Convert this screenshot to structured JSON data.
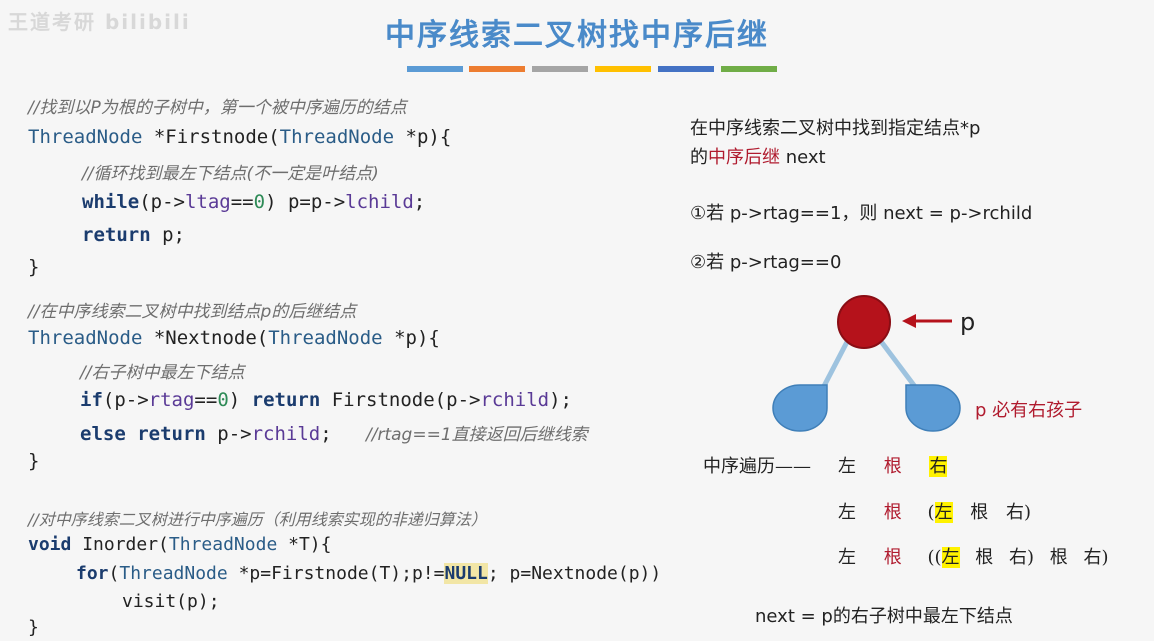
{
  "watermark": "王道考研 bilibili",
  "title": "中序线索二叉树找中序后继",
  "color_bars": [
    "#5b9bd5",
    "#ed7d31",
    "#a5a5a5",
    "#ffc000",
    "#4472c4",
    "#70ad47"
  ],
  "code": {
    "c1": "//找到以P为根的子树中，第一个被中序遍历的结点",
    "l1_type": "ThreadNode",
    "l1_rest": " *Firstnode(",
    "l1_type2": "ThreadNode",
    "l1_end": " *p){",
    "c2": "//循环找到最左下结点(不一定是叶结点)",
    "l2_kw": "while",
    "l2_a": "(p->",
    "l2_var": "ltag",
    "l2_b": "==",
    "l2_num": "0",
    "l2_c": ") p=p->",
    "l2_var2": "lchild",
    "l2_d": ";",
    "l3_kw": "return",
    "l3_rest": " p;",
    "l4": "}",
    "c3": "//在中序线索二叉树中找到结点p的后继结点",
    "l5_type": "ThreadNode",
    "l5_rest": " *Nextnode(",
    "l5_type2": "ThreadNode",
    "l5_end": " *p){",
    "c4": "//右子树中最左下结点",
    "l6_kw": "if",
    "l6_a": "(p->",
    "l6_var": "rtag",
    "l6_b": "==",
    "l6_num": "0",
    "l6_c": ") ",
    "l6_kw2": "return",
    "l6_d": " Firstnode(p->",
    "l6_var2": "rchild",
    "l6_e": ");",
    "l7_kw": "else return",
    "l7_a": " p->",
    "l7_var": "rchild",
    "l7_b": ";   ",
    "l7_comment": "//rtag==1直接返回后继线索",
    "l8": "}",
    "c5": "//对中序线索二叉树进行中序遍历（利用线索实现的非递归算法）",
    "l9_kw": "void",
    "l9_a": " Inorder(",
    "l9_type": "ThreadNode",
    "l9_b": " *T){",
    "l10_kw": "for",
    "l10_a": "(",
    "l10_type": "ThreadNode",
    "l10_b": " *p=Firstnode(T);p!=",
    "l10_null": "NULL",
    "l10_c": "; p=Nextnode(p))",
    "l11": "visit(p);",
    "l12": "}"
  },
  "right": {
    "line1": "在中序线索二叉树中找到指定结点*p",
    "line2_a": "的",
    "line2_red": "中序后继",
    "line2_b": " next",
    "case1": "①若 p->rtag==1，则 next = p->rchild",
    "case2": "②若 p->rtag==0",
    "p_label": "p",
    "must_have": "p 必有右孩子",
    "seq_label": "中序遍历——",
    "seq1": [
      "左",
      "根",
      "右"
    ],
    "seq2": [
      "左",
      "根",
      "(",
      "左",
      "根",
      "右",
      ")"
    ],
    "seq3": [
      "左",
      "根",
      "((",
      "左",
      "根",
      "右",
      ")",
      "根",
      "右",
      ")"
    ],
    "conclusion": "next = p的右子树中最左下结点"
  }
}
